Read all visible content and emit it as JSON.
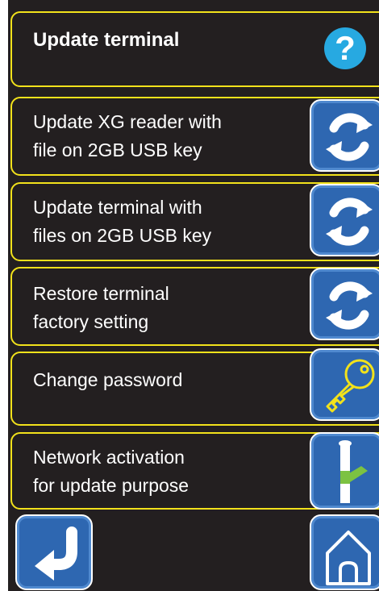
{
  "header": {
    "title": "Update terminal",
    "help_glyph": "?"
  },
  "menu": {
    "items": [
      {
        "label": "Update XG reader with\nfile on 2GB USB key",
        "icon": "refresh-icon"
      },
      {
        "label": "Update terminal with\nfiles on 2GB USB key",
        "icon": "refresh-icon"
      },
      {
        "label": "Restore terminal\nfactory setting",
        "icon": "refresh-icon"
      },
      {
        "label": "Change password",
        "icon": "key-icon"
      },
      {
        "label": "Network activation\nfor update purpose",
        "icon": "pipe-valve-icon"
      }
    ]
  },
  "footer": {
    "back_icon": "return-arrow-icon",
    "home_icon": "home-icon"
  },
  "colors": {
    "background": "#231f20",
    "border": "#f2e21b",
    "button": "#2e67b1",
    "help": "#27a9e1",
    "valve": "#7cc242"
  }
}
